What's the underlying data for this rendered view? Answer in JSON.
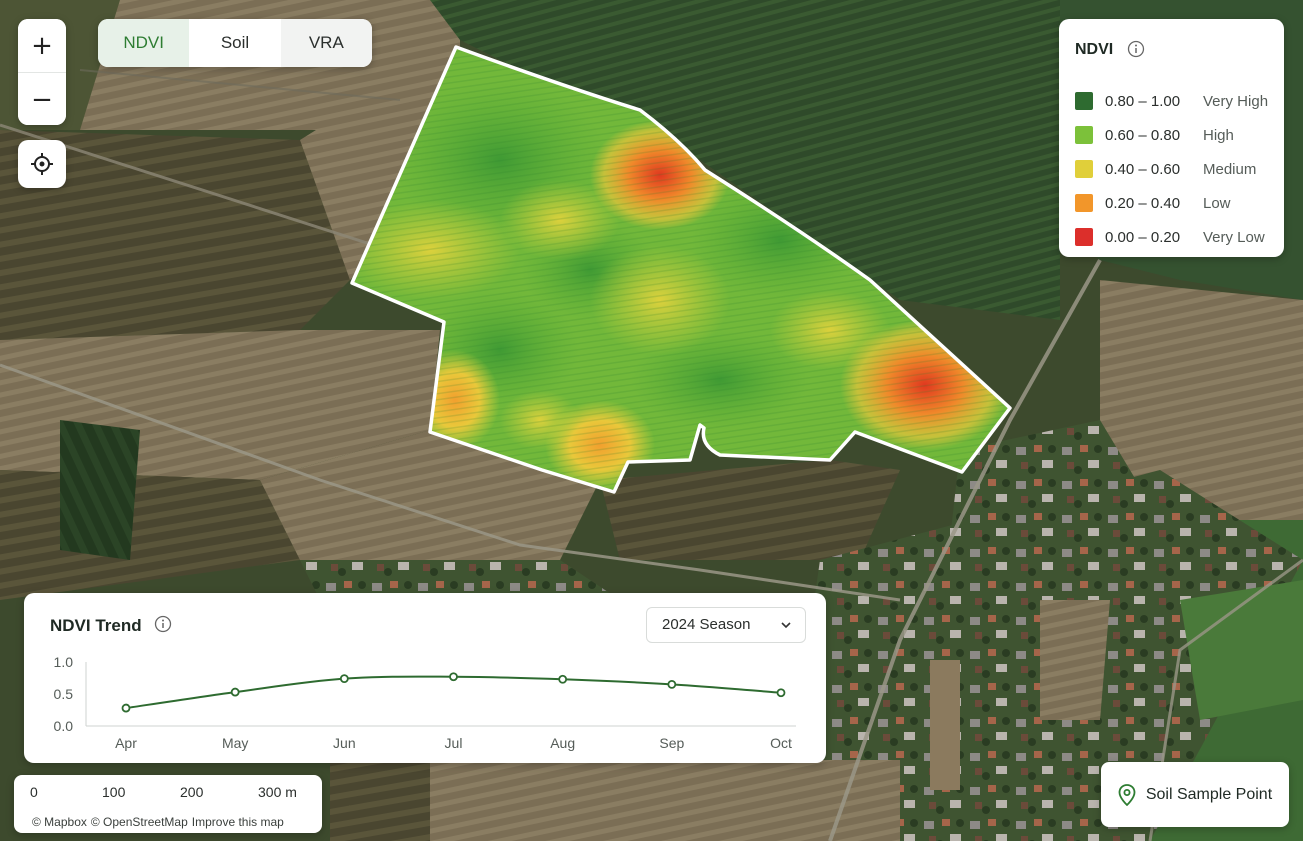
{
  "map_controls": {
    "zoom_in_label": "+",
    "zoom_out_label": "−",
    "locate_icon": "crosshair-icon"
  },
  "layer_tabs": [
    {
      "label": "NDVI",
      "active": true
    },
    {
      "label": "Soil",
      "active": false
    },
    {
      "label": "VRA",
      "active": false
    }
  ],
  "legend": {
    "title": "NDVI",
    "info_icon": "info-icon",
    "items": [
      {
        "range": "0.80 – 1.00",
        "level": "Very High",
        "color": "#2e6b30"
      },
      {
        "range": "0.60 – 0.80",
        "level": "High",
        "color": "#7cc13a"
      },
      {
        "range": "0.40 – 0.60",
        "level": "Medium",
        "color": "#e0cf3a"
      },
      {
        "range": "0.20 – 0.40",
        "level": "Low",
        "color": "#f2962a"
      },
      {
        "range": "0.00 – 0.20",
        "level": "Very Low",
        "color": "#dc2f2b"
      }
    ]
  },
  "trend": {
    "title": "NDVI Trend",
    "info_icon": "info-icon",
    "season_select": "2024 Season",
    "chart_data": {
      "type": "line",
      "categories": [
        "Apr",
        "May",
        "Jun",
        "Jul",
        "Aug",
        "Sep",
        "Oct"
      ],
      "values": [
        0.28,
        0.53,
        0.74,
        0.77,
        0.73,
        0.65,
        0.52
      ],
      "y_ticks": [
        "1.0",
        "0.5",
        "0.0"
      ],
      "ylim": [
        0,
        1
      ],
      "grid": false,
      "color": "#2e6b30"
    }
  },
  "scale_bar": {
    "ticks": [
      "0",
      "100",
      "200",
      "300 m"
    ],
    "attribution": [
      "© Mapbox",
      "© OpenStreetMap",
      "Improve this map"
    ]
  },
  "soil_button": {
    "label": "Soil Sample Point",
    "icon": "map-pin-icon"
  },
  "colors": {
    "accent": "#2e7d32",
    "boundary": "#ffffff"
  }
}
